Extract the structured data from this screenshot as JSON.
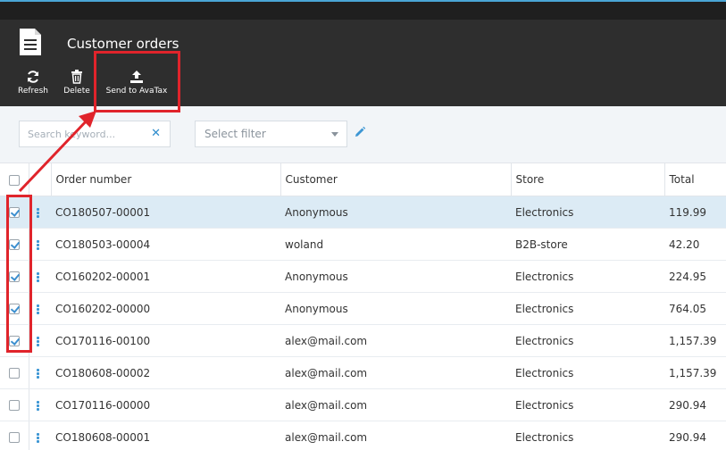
{
  "header": {
    "title": "Customer orders"
  },
  "toolbar": {
    "refresh_label": "Refresh",
    "delete_label": "Delete",
    "send_label": "Send to AvaTax"
  },
  "filters": {
    "search_placeholder": "Search keyword...",
    "select_placeholder": "Select filter"
  },
  "table": {
    "columns": [
      "Order number",
      "Customer",
      "Store",
      "Total"
    ],
    "rows": [
      {
        "order": "CO180507-00001",
        "customer": "Anonymous",
        "store": "Electronics",
        "total": "119.99",
        "checked": true,
        "selected": true
      },
      {
        "order": "CO180503-00004",
        "customer": "woland",
        "store": "B2B-store",
        "total": "42.20",
        "checked": true,
        "selected": false
      },
      {
        "order": "CO160202-00001",
        "customer": "Anonymous",
        "store": "Electronics",
        "total": "224.95",
        "checked": true,
        "selected": false
      },
      {
        "order": "CO160202-00000",
        "customer": "Anonymous",
        "store": "Electronics",
        "total": "764.05",
        "checked": true,
        "selected": false
      },
      {
        "order": "CO170116-00100",
        "customer": "alex@mail.com",
        "store": "Electronics",
        "total": "1,157.39",
        "checked": true,
        "selected": false
      },
      {
        "order": "CO180608-00002",
        "customer": "alex@mail.com",
        "store": "Electronics",
        "total": "1,157.39",
        "checked": false,
        "selected": false
      },
      {
        "order": "CO170116-00000",
        "customer": "alex@mail.com",
        "store": "Electronics",
        "total": "290.94",
        "checked": false,
        "selected": false
      },
      {
        "order": "CO180608-00001",
        "customer": "alex@mail.com",
        "store": "Electronics",
        "total": "290.94",
        "checked": false,
        "selected": false
      }
    ]
  },
  "icons": {
    "page": "document-icon",
    "refresh": "refresh-icon",
    "delete": "trash-icon",
    "send": "upload-icon",
    "clear": "close-icon",
    "edit": "pencil-icon",
    "row_menu": "kebab-menu-icon"
  },
  "colors": {
    "header_bg": "#2e2e2e",
    "accent": "#3c96d4",
    "selected_row": "#dcebf5",
    "highlight": "#e0242b"
  }
}
